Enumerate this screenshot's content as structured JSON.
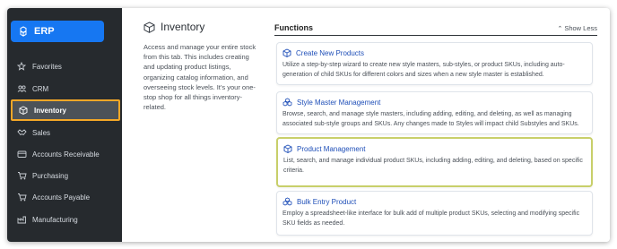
{
  "sidebar": {
    "brand": "ERP",
    "items": [
      {
        "label": "Favorites",
        "icon": "star-icon"
      },
      {
        "label": "CRM",
        "icon": "users-icon"
      },
      {
        "label": "Inventory",
        "icon": "box-icon",
        "active": true
      },
      {
        "label": "Sales",
        "icon": "handshake-icon"
      },
      {
        "label": "Accounts Receivable",
        "icon": "receipt-icon"
      },
      {
        "label": "Purchasing",
        "icon": "cart-icon"
      },
      {
        "label": "Accounts Payable",
        "icon": "cart-icon"
      },
      {
        "label": "Manufacturing",
        "icon": "factory-icon"
      }
    ]
  },
  "info": {
    "title": "Inventory",
    "description": "Access and manage your entire stock from this tab. This includes creating and updating product listings, organizing catalog information, and overseeing stock levels. It’s your one-stop shop for all things inventory-related."
  },
  "functions": {
    "heading": "Functions",
    "toggle_label": "Show Less",
    "cards": [
      {
        "title": "Create New Products",
        "description": "Utilize a step-by-step wizard to create new style masters, sub-styles, or product SKUs, including auto-generation of child SKUs for different colors and sizes when a new style master is established."
      },
      {
        "title": "Style Master Management",
        "description": "Browse, search, and manage style masters, including adding, editing, and deleting, as well as managing associated sub-style groups and SKUs. Any changes made to Styles will impact child Substyles and SKUs."
      },
      {
        "title": "Product Management",
        "description": "List, search, and manage individual product SKUs, including adding, editing, and deleting, based on specific criteria."
      },
      {
        "title": "Bulk Entry Product",
        "description": "Employ a spreadsheet-like interface for bulk add of multiple product SKUs, selecting and modifying specific SKU fields as needed."
      }
    ]
  },
  "colors": {
    "sidebar_bg": "#262a2e",
    "brand_bg": "#1677f2",
    "active_border": "#f4a727",
    "card_highlight": "#c8cf6a",
    "link_blue": "#1f4fb8"
  }
}
